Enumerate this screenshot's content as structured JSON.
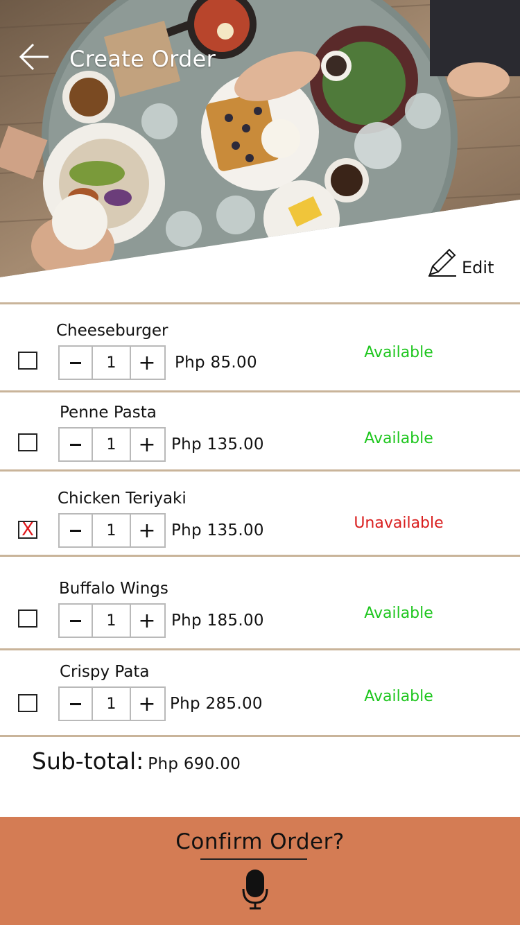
{
  "header": {
    "title": "Create Order",
    "back_icon": "arrow-left-icon"
  },
  "edit": {
    "label": "Edit",
    "icon": "pencil-icon"
  },
  "items": [
    {
      "name": "Cheeseburger",
      "quantity": "1",
      "price": "Php 85.00",
      "status": "Available",
      "checked": false
    },
    {
      "name": "Penne Pasta",
      "quantity": "1",
      "price": "Php 135.00",
      "status": "Available",
      "checked": false
    },
    {
      "name": "Chicken Teriyaki",
      "quantity": "1",
      "price": "Php 135.00",
      "status": "Unavailable",
      "checked": true
    },
    {
      "name": "Buffalo Wings",
      "quantity": "1",
      "price": "Php 185.00",
      "status": "Available",
      "checked": false
    },
    {
      "name": "Crispy Pata",
      "quantity": "1",
      "price": "Php 285.00",
      "status": "Available",
      "checked": false
    }
  ],
  "stepper": {
    "minus": "-",
    "plus": "+"
  },
  "checkbox_mark": "X",
  "subtotal": {
    "label": "Sub-total:",
    "amount": "Php 690.00"
  },
  "confirm": {
    "label": "Confirm Order?",
    "mic_icon": "microphone-icon"
  },
  "colors": {
    "available": "#1ec61e",
    "unavailable": "#d91d1d",
    "divider": "#c9b49a",
    "confirm_bar": "#d47c54",
    "stepper_border": "#b9b9b9"
  }
}
